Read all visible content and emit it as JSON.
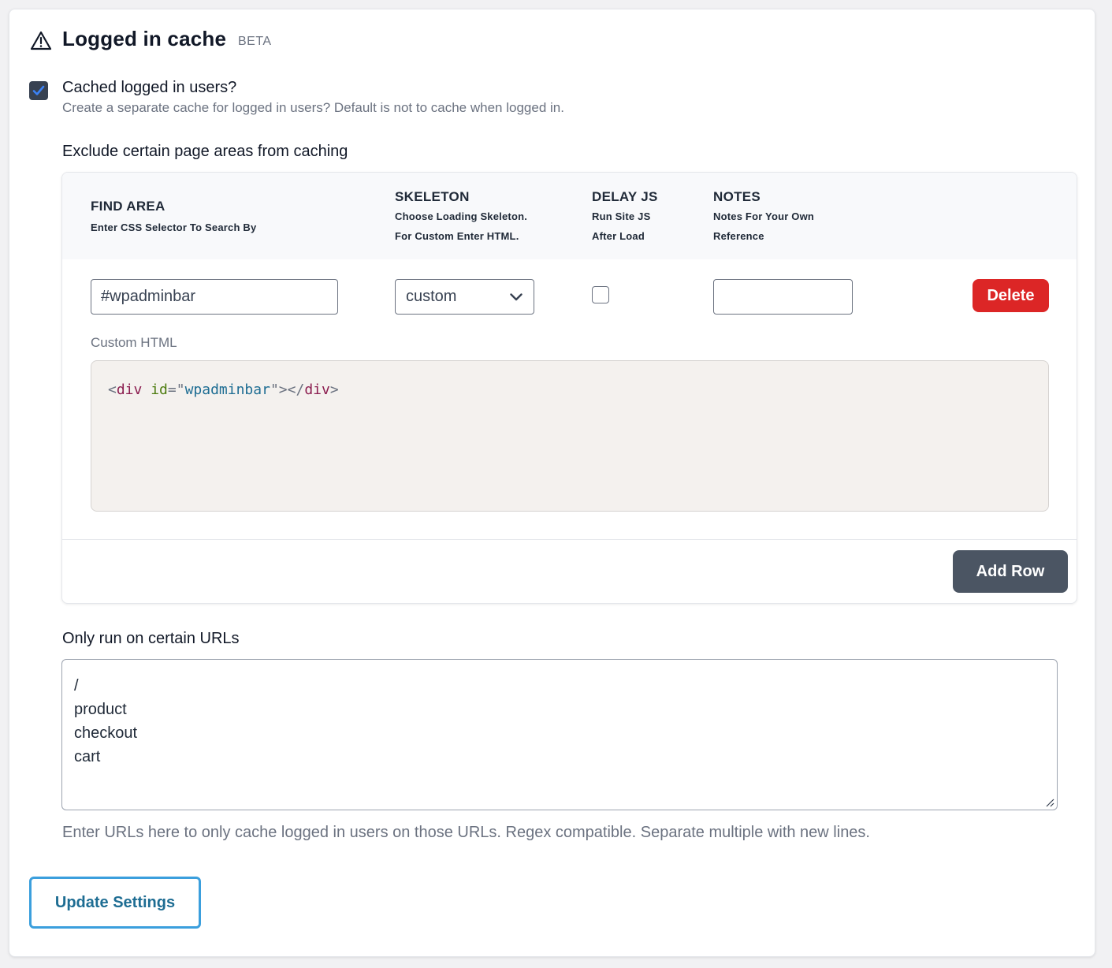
{
  "header": {
    "title": "Logged in cache",
    "badge": "BETA",
    "icon": "warning-triangle-icon"
  },
  "logged_in_option": {
    "checked": true,
    "label": "Cached logged in users?",
    "description": "Create a separate cache for logged in users? Default is not to cache when logged in."
  },
  "exclude_section": {
    "heading": "Exclude certain page areas from caching",
    "columns": [
      {
        "title": "FIND AREA",
        "sub": [
          "Enter CSS Selector To Search By"
        ]
      },
      {
        "title": "SKELETON",
        "sub": [
          "Choose Loading Skeleton.",
          "For Custom Enter HTML."
        ]
      },
      {
        "title": "DELAY JS",
        "sub": [
          "Run Site JS",
          "After Load"
        ]
      },
      {
        "title": "NOTES",
        "sub": [
          "Notes For Your Own",
          "Reference"
        ]
      }
    ],
    "rows": [
      {
        "find_area": "#wpadminbar",
        "skeleton": "custom",
        "delay_js": false,
        "notes": "",
        "delete_label": "Delete",
        "custom_html_label": "Custom HTML",
        "custom_html": {
          "open_bracket": "<",
          "tag": "div",
          "attr": "id",
          "eq": "=",
          "quote_open": "\"",
          "value": "wpadminbar",
          "quote_close": "\"",
          "close_gt": ">",
          "close_open": "</",
          "close_tag": "div",
          "close_end": ">"
        }
      }
    ],
    "add_row_label": "Add Row"
  },
  "urls_section": {
    "heading": "Only run on certain URLs",
    "lines": [
      "/",
      "product",
      "checkout",
      "cart"
    ],
    "help": "Enter URLs here to only cache logged in users on those URLs. Regex compatible. Separate multiple with new lines."
  },
  "update_button": "Update Settings",
  "colors": {
    "delete": "#dc2626",
    "add_row": "#4b5563",
    "update_border": "#3b9fdd",
    "checkbox": "#374151",
    "check_mark": "#3b82f6"
  }
}
